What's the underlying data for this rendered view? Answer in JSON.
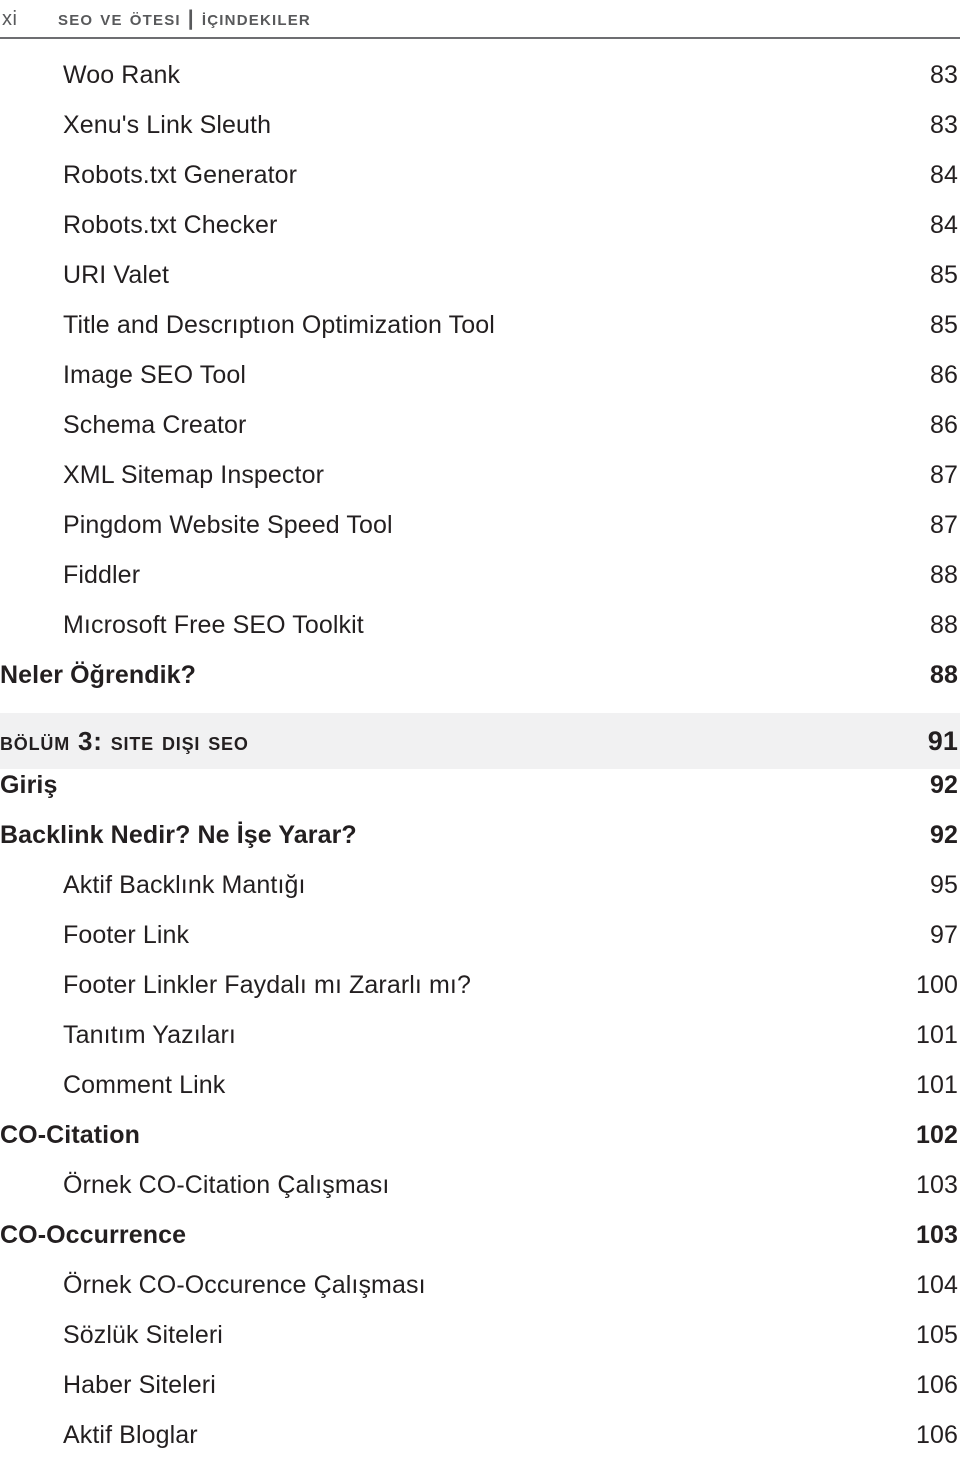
{
  "header": {
    "folio": "xi",
    "title": "SEO ve Ötesi | İçindekiler"
  },
  "toc": {
    "rows": [
      {
        "level": 2,
        "label": "Woo Rank",
        "page": "83"
      },
      {
        "level": 2,
        "label": "Xenu's Link Sleuth",
        "page": "83"
      },
      {
        "level": 2,
        "label": "Robots.txt Generator",
        "page": "84"
      },
      {
        "level": 2,
        "label": "Robots.txt Checker",
        "page": "84"
      },
      {
        "level": 2,
        "label": "URI Valet",
        "page": "85"
      },
      {
        "level": 2,
        "label": "Title and Descrıptıon Optimization Tool",
        "page": "85"
      },
      {
        "level": 2,
        "label": "Image SEO Tool",
        "page": "86"
      },
      {
        "level": 2,
        "label": "Schema Creator",
        "page": "86"
      },
      {
        "level": 2,
        "label": "XML Sitemap Inspector",
        "page": "87"
      },
      {
        "level": 2,
        "label": "Pingdom Website Speed Tool",
        "page": "87"
      },
      {
        "level": 2,
        "label": "Fiddler",
        "page": "88"
      },
      {
        "level": 2,
        "label": "Mıcrosoft Free SEO Toolkit",
        "page": "88"
      },
      {
        "level": 1,
        "label": "Neler Öğrendik?",
        "page": "88"
      },
      {
        "level": "chapter",
        "label": "Bölüm 3: Site Dışı SEO",
        "page": "91"
      },
      {
        "level": 1,
        "label": "Giriş",
        "page": "92"
      },
      {
        "level": 1,
        "label": "Backlink Nedir? Ne İşe Yarar?",
        "page": "92"
      },
      {
        "level": 2,
        "label": "Aktif Backlınk Mantığı",
        "page": "95"
      },
      {
        "level": 2,
        "label": "Footer Link",
        "page": "97"
      },
      {
        "level": 2,
        "label": "Footer Linkler Faydalı mı Zararlı mı?",
        "page": "100"
      },
      {
        "level": 2,
        "label": "Tanıtım Yazıları",
        "page": "101"
      },
      {
        "level": 2,
        "label": "Comment Link",
        "page": "101"
      },
      {
        "level": 1,
        "label": "CO-Citation",
        "page": "102"
      },
      {
        "level": 2,
        "label": "Örnek CO-Citation Çalışması",
        "page": "103"
      },
      {
        "level": 1,
        "label": "CO-Occurrence",
        "page": "103"
      },
      {
        "level": 2,
        "label": "Örnek CO-Occurence Çalışması",
        "page": "104"
      },
      {
        "level": 2,
        "label": "Sözlük Siteleri",
        "page": "105"
      },
      {
        "level": 2,
        "label": "Haber Siteleri",
        "page": "106"
      },
      {
        "level": 2,
        "label": "Aktif Bloglar",
        "page": "106"
      }
    ]
  },
  "colors": {
    "text": "#231f20",
    "header_text": "#58595b",
    "rule": "#6d6e71",
    "chapter_band": "#f1f1f2"
  }
}
